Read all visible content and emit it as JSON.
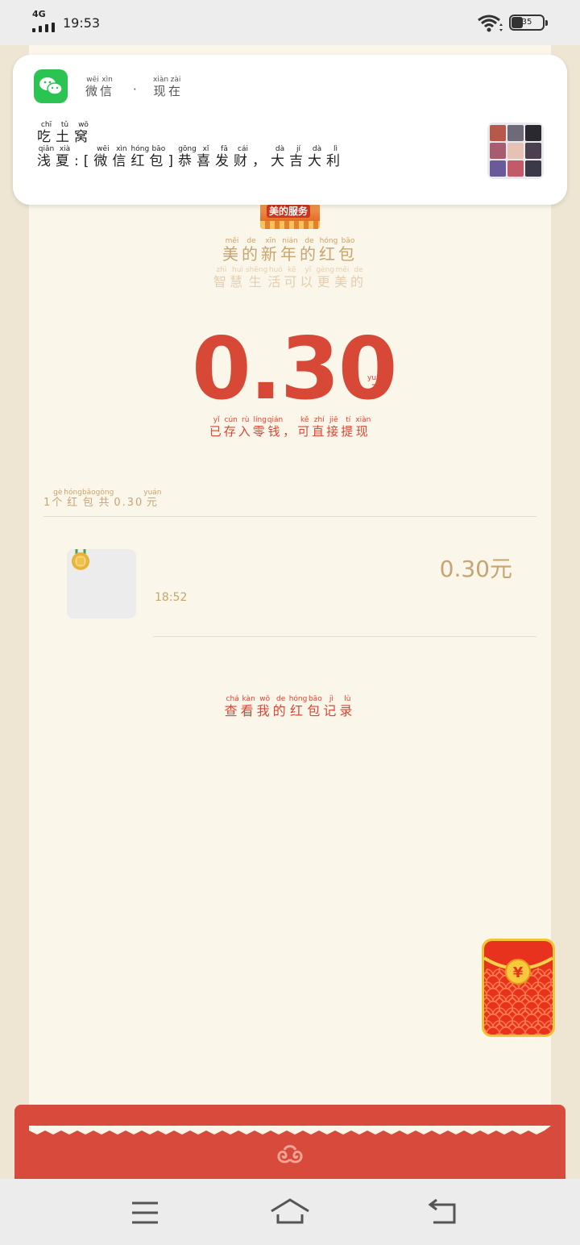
{
  "status_bar": {
    "network": "4G",
    "time": "19:53",
    "battery": "35"
  },
  "notification": {
    "app_name": [
      {
        "char": "微",
        "pinyin": "wēi"
      },
      {
        "char": "信",
        "pinyin": "xìn"
      }
    ],
    "separator": "·",
    "time": [
      {
        "char": "现",
        "pinyin": "xiàn"
      },
      {
        "char": "在",
        "pinyin": "zài"
      }
    ],
    "sender": [
      {
        "char": "吃",
        "pinyin": "chī"
      },
      {
        "char": "土",
        "pinyin": "tǔ"
      },
      {
        "char": "窝",
        "pinyin": "wō"
      }
    ],
    "message": [
      {
        "char": "浅",
        "pinyin": "qiǎn"
      },
      {
        "char": "夏",
        "pinyin": "xià"
      },
      {
        "char": ":[",
        "pinyin": ""
      },
      {
        "char": "微",
        "pinyin": "wēi"
      },
      {
        "char": "信",
        "pinyin": "xìn"
      },
      {
        "char": "红",
        "pinyin": "hóng"
      },
      {
        "char": "包",
        "pinyin": "bāo"
      },
      {
        "char": "]",
        "pinyin": ""
      },
      {
        "char": "恭",
        "pinyin": "gōng"
      },
      {
        "char": "喜",
        "pinyin": "xǐ"
      },
      {
        "char": "发",
        "pinyin": "fā"
      },
      {
        "char": "财",
        "pinyin": "cái"
      },
      {
        "char": "，",
        "pinyin": ""
      },
      {
        "char": "大",
        "pinyin": "dà"
      },
      {
        "char": "吉",
        "pinyin": "jí"
      },
      {
        "char": "大",
        "pinyin": "dà"
      },
      {
        "char": "利",
        "pinyin": "lì"
      }
    ],
    "colors": {
      "app_icon": "#2bc452"
    }
  },
  "red_packet": {
    "brand_badge": "美的服务",
    "title": [
      {
        "char": "美",
        "pinyin": "měi"
      },
      {
        "char": "的",
        "pinyin": "de"
      },
      {
        "char": "新",
        "pinyin": "xīn"
      },
      {
        "char": "年",
        "pinyin": "nián"
      },
      {
        "char": "的",
        "pinyin": "de"
      },
      {
        "char": "红",
        "pinyin": "hóng"
      },
      {
        "char": "包",
        "pinyin": "bāo"
      }
    ],
    "subtitle": [
      {
        "char": "智",
        "pinyin": "zhì"
      },
      {
        "char": "慧",
        "pinyin": "huì"
      },
      {
        "char": "生",
        "pinyin": "shēng"
      },
      {
        "char": "活",
        "pinyin": "huó"
      },
      {
        "char": "可",
        "pinyin": "kě"
      },
      {
        "char": "以",
        "pinyin": "yǐ"
      },
      {
        "char": "更",
        "pinyin": "gèng"
      },
      {
        "char": "美",
        "pinyin": "měi"
      },
      {
        "char": "的",
        "pinyin": "de"
      }
    ],
    "amount": "0.30",
    "amount_unit": [
      {
        "char": "元",
        "pinyin": "yuán"
      }
    ],
    "amount_note": [
      {
        "char": "已",
        "pinyin": "yǐ"
      },
      {
        "char": "存",
        "pinyin": "cún"
      },
      {
        "char": "入",
        "pinyin": "rù"
      },
      {
        "char": "零",
        "pinyin": "líng"
      },
      {
        "char": "钱",
        "pinyin": "qián"
      },
      {
        "char": "，",
        "pinyin": ""
      },
      {
        "char": "可",
        "pinyin": "kě"
      },
      {
        "char": "直",
        "pinyin": "zhí"
      },
      {
        "char": "接",
        "pinyin": "jiē"
      },
      {
        "char": "提",
        "pinyin": "tí"
      },
      {
        "char": "现",
        "pinyin": "xiàn"
      }
    ],
    "summary": [
      {
        "char": "1",
        "pinyin": ""
      },
      {
        "char": "个",
        "pinyin": "gè"
      },
      {
        "char": "红",
        "pinyin": "hóng"
      },
      {
        "char": "包",
        "pinyin": "bāo"
      },
      {
        "char": "共",
        "pinyin": "gòng"
      },
      {
        "char": "0.30",
        "pinyin": ""
      },
      {
        "char": "元",
        "pinyin": "yuán"
      }
    ],
    "records": [
      {
        "time": "18:52",
        "amount": "0.30元"
      }
    ],
    "history_link": [
      {
        "char": "查",
        "pinyin": "chá"
      },
      {
        "char": "看",
        "pinyin": "kàn"
      },
      {
        "char": "我",
        "pinyin": "wǒ"
      },
      {
        "char": "的",
        "pinyin": "de"
      },
      {
        "char": "红",
        "pinyin": "hóng"
      },
      {
        "char": "包",
        "pinyin": "bāo"
      },
      {
        "char": "记",
        "pinyin": "jì"
      },
      {
        "char": "录",
        "pinyin": "lù"
      }
    ],
    "floating_packet_symbol": "¥",
    "colors": {
      "accent_red": "#d74836",
      "gold": "#c6a572",
      "background": "#faf6ea"
    }
  },
  "nav_bar": {
    "icons": [
      "menu-icon",
      "home-icon",
      "back-icon"
    ]
  }
}
